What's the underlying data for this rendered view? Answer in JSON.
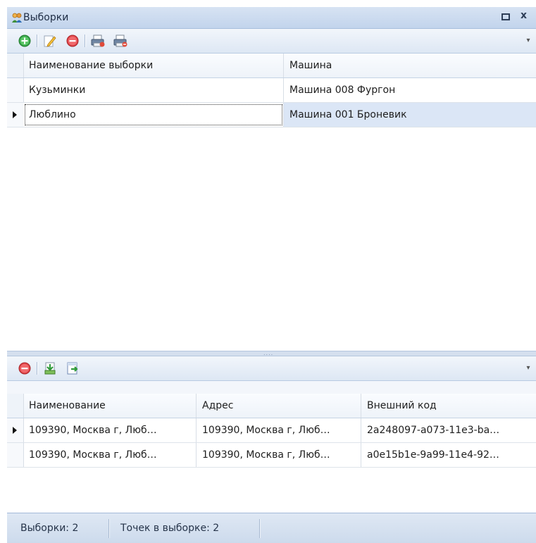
{
  "window": {
    "title": "Выборки",
    "controls": {
      "restore_icon": "restore-icon",
      "close_icon": "close-icon",
      "close_glyph": "x"
    }
  },
  "top_toolbar": {
    "buttons": [
      "add-icon",
      "edit-icon",
      "delete-icon",
      "print-icon",
      "print-remove-icon"
    ],
    "more": "▾"
  },
  "samples_grid": {
    "columns": [
      "Наименование выборки",
      "Машина"
    ],
    "rows": [
      {
        "name": "Кузьминки",
        "vehicle": "Машина 008 Фургон",
        "selected": false
      },
      {
        "name": "Люблино",
        "vehicle": "Машина 001 Броневик",
        "selected": true
      }
    ]
  },
  "splitter_grip": "....",
  "bottom_toolbar": {
    "buttons": [
      "delete-icon",
      "import-icon",
      "export-icon"
    ],
    "more": "▾"
  },
  "points_grid": {
    "columns": [
      "Наименование",
      "Адрес",
      "Внешний код"
    ],
    "rows": [
      {
        "name": "109390, Москва г, Люб…",
        "address": "109390, Москва г, Люб…",
        "code": "2a248097-a073-11e3-ba…",
        "current": true
      },
      {
        "name": "109390, Москва г, Люб…",
        "address": "109390, Москва г, Люб…",
        "code": "a0e15b1e-9a99-11e4-92…",
        "current": false
      }
    ]
  },
  "status": {
    "samples": "Выборки: 2",
    "points": "Точек в выборке: 2"
  },
  "colors": {
    "title_bar": "#c8d8ee",
    "selection": "#dbe6f6",
    "add": "#3aa84a",
    "delete": "#e2474b"
  }
}
